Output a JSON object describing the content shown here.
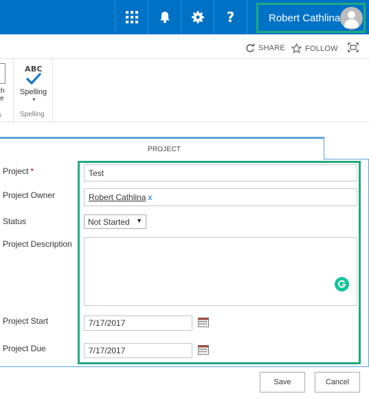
{
  "suite_bar": {
    "user_name": "Robert Cathlina",
    "help_glyph": "?",
    "icons": [
      "app-launcher-icon",
      "notification-bell-icon",
      "settings-gear-icon",
      "help-icon",
      "avatar-icon"
    ],
    "accent_color": "#0072c6",
    "highlight_color": "#1fa980"
  },
  "action_bar": {
    "share_label": "SHARE",
    "follow_label": "FOLLOW"
  },
  "ribbon": {
    "clipped_label_line1": "ch",
    "clipped_label_line2": "e",
    "clipped_group": "ons",
    "spelling_icon_text": "ABC",
    "spelling_label": "Spelling",
    "spelling_group": "Spelling"
  },
  "form": {
    "tab_title": "PROJECT",
    "fields": {
      "project": {
        "label": "Project",
        "required_mark": "*",
        "value": "Test"
      },
      "owner": {
        "label": "Project Owner",
        "person": "Robert Cathlina",
        "remove_glyph": "x"
      },
      "status": {
        "label": "Status",
        "selected": "Not Started"
      },
      "description": {
        "label": "Project Description",
        "value": ""
      },
      "start": {
        "label": "Project Start",
        "value": "7/17/2017"
      },
      "due": {
        "label": "Project Due",
        "value": "7/17/2017"
      }
    }
  },
  "buttons": {
    "save": "Save",
    "cancel": "Cancel"
  }
}
